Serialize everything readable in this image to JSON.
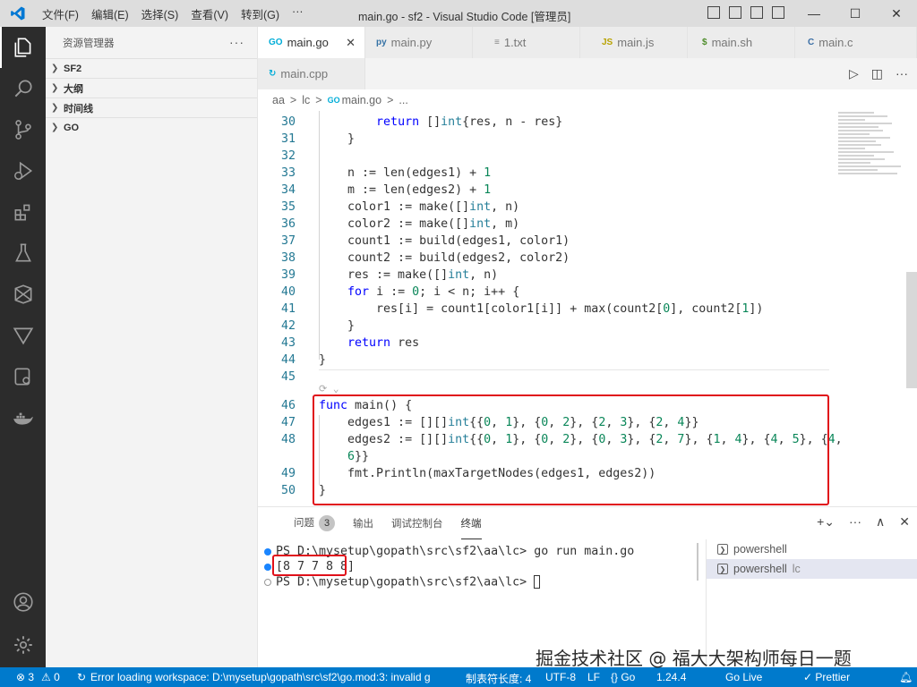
{
  "window": {
    "title": "main.go - sf2 - Visual Studio Code [管理员]",
    "menu": [
      "文件(F)",
      "编辑(E)",
      "选择(S)",
      "查看(V)",
      "转到(G)",
      "···"
    ],
    "controls": [
      "—",
      "☐",
      "✕"
    ]
  },
  "sidebar": {
    "title": "资源管理器",
    "more": "···",
    "sections": [
      "SF2",
      "大纲",
      "时间线",
      "GO"
    ]
  },
  "tabs": [
    {
      "icon": "GO",
      "label": "main.go",
      "active": true
    },
    {
      "icon": "py",
      "label": "main.py"
    },
    {
      "icon": "txt",
      "label": "1.txt"
    },
    {
      "icon": "JS",
      "label": "main.js"
    },
    {
      "icon": "$",
      "label": "main.sh"
    },
    {
      "icon": "C",
      "label": "main.c"
    },
    {
      "icon": "C++",
      "label": "main.cpp"
    }
  ],
  "breadcrumb": [
    "aa",
    ">",
    "lc",
    ">",
    "main.go",
    ">",
    "..."
  ],
  "editor": {
    "lines": [
      {
        "n": "30",
        "code": "        return []int{res, n - res}"
      },
      {
        "n": "31",
        "code": "    }"
      },
      {
        "n": "32",
        "code": ""
      },
      {
        "n": "33",
        "code": "    n := len(edges1) + 1"
      },
      {
        "n": "34",
        "code": "    m := len(edges2) + 1"
      },
      {
        "n": "35",
        "code": "    color1 := make([]int, n)"
      },
      {
        "n": "36",
        "code": "    color2 := make([]int, m)"
      },
      {
        "n": "37",
        "code": "    count1 := build(edges1, color1)"
      },
      {
        "n": "38",
        "code": "    count2 := build(edges2, color2)"
      },
      {
        "n": "39",
        "code": "    res := make([]int, n)"
      },
      {
        "n": "40",
        "code": "    for i := 0; i < n; i++ {"
      },
      {
        "n": "41",
        "code": "        res[i] = count1[color1[i]] + max(count2[0], count2[1])"
      },
      {
        "n": "42",
        "code": "    }"
      },
      {
        "n": "43",
        "code": "    return res"
      },
      {
        "n": "44",
        "code": "}"
      },
      {
        "n": "45",
        "code": ""
      },
      {
        "n": "46",
        "code": "func main() {"
      },
      {
        "n": "47",
        "code": "    edges1 := [][]int{{0, 1}, {0, 2}, {2, 3}, {2, 4}}"
      },
      {
        "n": "48",
        "code": "    edges2 := [][]int{{0, 1}, {0, 2}, {0, 3}, {2, 7}, {1, 4}, {4, 5}, {4,"
      },
      {
        "n": "",
        "code": "    6}}"
      },
      {
        "n": "49",
        "code": "    fmt.Println(maxTargetNodes(edges1, edges2))"
      },
      {
        "n": "50",
        "code": "}"
      }
    ]
  },
  "panel": {
    "tabs": [
      "问题",
      "输出",
      "调试控制台",
      "终端"
    ],
    "problems_count": "3",
    "terminal_lines": [
      "PS D:\\mysetup\\gopath\\src\\sf2\\aa\\lc> go run main.go",
      "[8 7 7 8 8]",
      "PS D:\\mysetup\\gopath\\src\\sf2\\aa\\lc> "
    ],
    "terminals": [
      {
        "label": "powershell",
        "suffix": ""
      },
      {
        "label": "powershell",
        "suffix": "lc"
      }
    ]
  },
  "statusbar": {
    "errors": "⊗ 3",
    "warnings": "⚠ 0",
    "message": "Error loading workspace: D:\\mysetup\\gopath\\src\\sf2\\go.mod:3: invalid g",
    "tab_size": "制表符长度: 4",
    "encoding": "UTF-8",
    "eol": "LF",
    "language": "{} Go",
    "go_version": "1.24.4",
    "go_live": "Go Live",
    "prettier": "✓ Prettier"
  },
  "watermark": "掘金技术社区 @ 福大大架构师每日一题"
}
